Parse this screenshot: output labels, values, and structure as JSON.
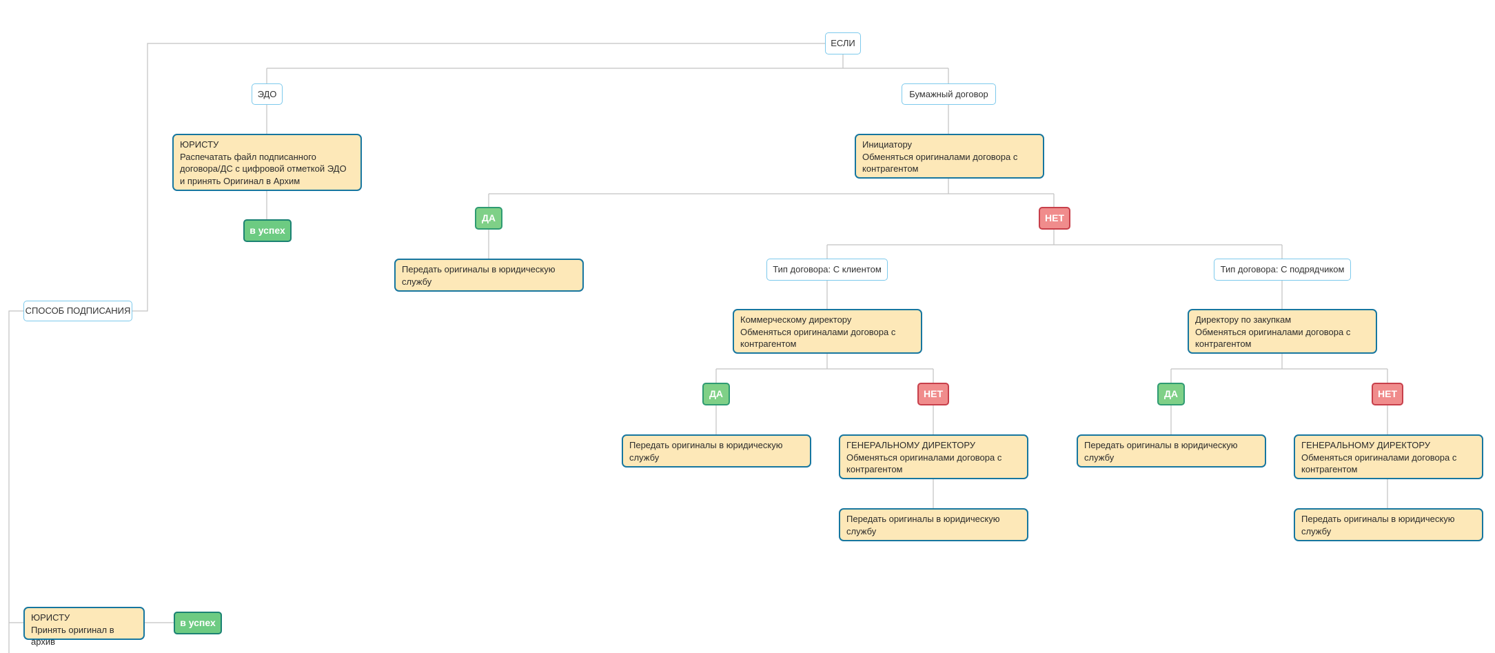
{
  "diagram": {
    "colors": {
      "condition_border": "#7cc9ec",
      "task_fill": "#fde8b8",
      "task_border": "#16769f",
      "yes_fill": "#7fd087",
      "no_fill": "#f08c8c",
      "success_fill": "#6dcb82",
      "edge": "#c2c2c2"
    },
    "nodes": {
      "root": "СПОСОБ ПОДПИСАНИЯ",
      "if": "ЕСЛИ",
      "edo": "ЭДО",
      "paper": "Бумажный договор",
      "jurist_edo": {
        "role": "ЮРИСТУ",
        "lines": [
          "Распечатать файл подписанного",
          "договора/ДС с цифровой отметкой ЭДО",
          "и принять Оригинал в Архим"
        ]
      },
      "success_edo": "в успех",
      "initiator": {
        "role": "Инициатору",
        "lines": [
          "Обменяться оригиналами договора с",
          "контрагентом"
        ]
      },
      "yes_1": "ДА",
      "no_1": "НЕТ",
      "handover_1": {
        "lines": [
          "Передать оригиналы в юридическую",
          "службу"
        ]
      },
      "type_client": "Тип договора: С клиентом",
      "type_contractor": "Тип договора: С подрядчиком",
      "commercial_director": {
        "role": "Коммерческому директору",
        "lines": [
          "Обменяться оригиналами договора с",
          "контрагентом"
        ]
      },
      "purchase_director": {
        "role": "Директору по закупкам",
        "lines": [
          "Обменяться оригиналами договора с",
          "контрагентом"
        ]
      },
      "yes_2": "ДА",
      "no_2": "НЕТ",
      "yes_3": "ДА",
      "no_3": "НЕТ",
      "handover_2": {
        "lines": [
          "Передать оригиналы в юридическую",
          "службу"
        ]
      },
      "general_director_1": {
        "role": "ГЕНЕРАЛЬНОМУ ДИРЕКТОРУ",
        "lines": [
          "Обменяться оригиналами договора с",
          "контрагентом"
        ]
      },
      "handover_3": {
        "lines": [
          "Передать оригиналы в юридическую",
          "службу"
        ]
      },
      "general_director_2": {
        "role": "ГЕНЕРАЛЬНОМУ ДИРЕКТОРУ",
        "lines": [
          "Обменяться оригиналами договора с",
          "контрагентом"
        ]
      },
      "handover_4": {
        "lines": [
          "Передать оригиналы в юридическую",
          "службу"
        ]
      },
      "handover_5": {
        "lines": [
          "Передать оригиналы в юридическую",
          "службу"
        ]
      },
      "jurist_archive": {
        "role": "ЮРИСТУ",
        "lines": [
          "Принять оригинал в архив"
        ]
      },
      "success_archive": "в успех"
    }
  }
}
